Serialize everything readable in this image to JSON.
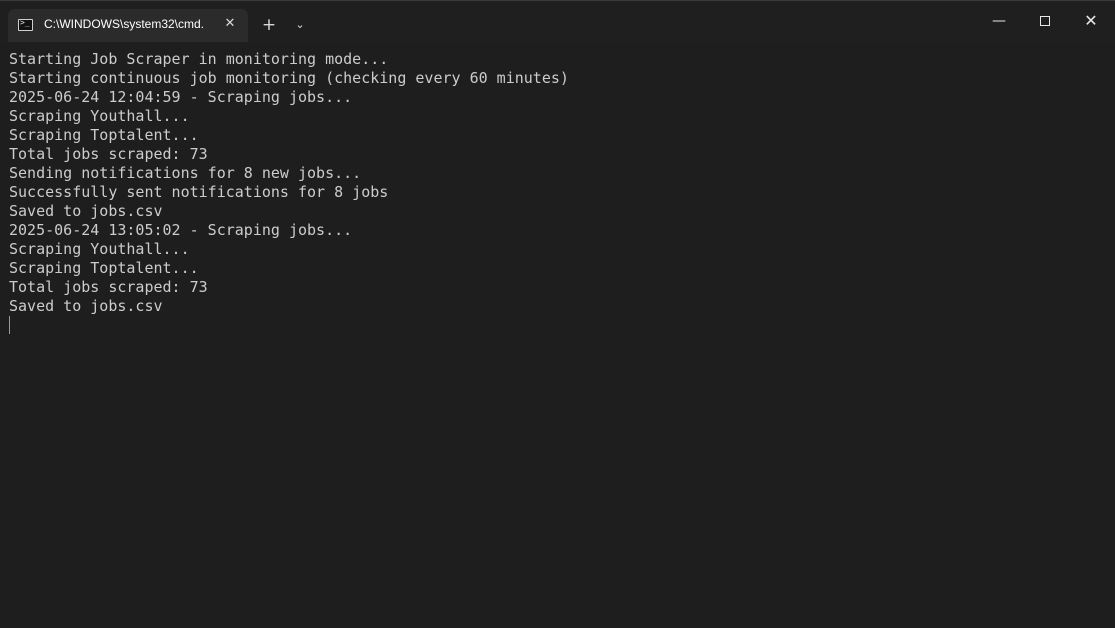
{
  "tab": {
    "title": "C:\\WINDOWS\\system32\\cmd.",
    "icon": "cmd-icon",
    "close_glyph": "✕"
  },
  "titlebar": {
    "new_tab_glyph": "+",
    "dropdown_glyph": "⌄",
    "minimize_glyph": "—",
    "close_glyph": "✕"
  },
  "terminal": {
    "lines": [
      "Starting Job Scraper in monitoring mode...",
      "Starting continuous job monitoring (checking every 60 minutes)",
      "2025-06-24 12:04:59 - Scraping jobs...",
      "Scraping Youthall...",
      "Scraping Toptalent...",
      "Total jobs scraped: 73",
      "Sending notifications for 8 new jobs...",
      "Successfully sent notifications for 8 jobs",
      "Saved to jobs.csv",
      "2025-06-24 13:05:02 - Scraping jobs...",
      "Scraping Youthall...",
      "Scraping Toptalent...",
      "Total jobs scraped: 73",
      "Saved to jobs.csv"
    ]
  },
  "colors": {
    "background": "#1e1e1e",
    "text": "#cccccc",
    "tab_active": "#2b2b2b"
  }
}
